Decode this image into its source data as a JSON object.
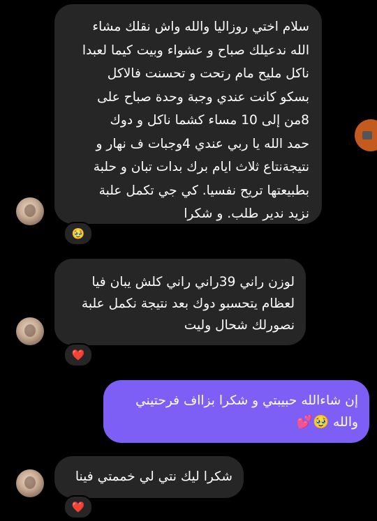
{
  "messages": [
    {
      "direction": "incoming",
      "lines": [
        "سلام اختي روزاليا والله واش نقلك مشاء",
        "الله ندعيلك صباح و عشواء وبيت كيما لعبدا",
        "ناكل مليح مام رتحت   و تحسنت فالاكل",
        "بسكو كانت عندي وجبة وحدة صباح على",
        "8من  إلى 10 مساء كشما ناكل  و دوك",
        "حمد الله يا ربي عندي 4وجبات ف نهار و",
        "نتيجةنتاع ثلاث ايام برك بدات تبان و حلبة",
        "بطبيعتها تريح نفسيا. كي  جي تكمل علبة",
        "نزيد  ندير طلب. و شكرا"
      ],
      "reaction": "🥹"
    },
    {
      "direction": "incoming",
      "lines": [
        "لوزن راني 39راني  راني كلش يبان فيا",
        "لعظام يتحسبو دوك بعد نتيجة نكمل علبة",
        "نصورلك شحال وليت"
      ],
      "reaction": "❤️"
    },
    {
      "direction": "outgoing",
      "lines": [
        "إن شاءالله حبيبتي و شكرا بزااف فرحتيني",
        "والله 🥹💕"
      ]
    },
    {
      "direction": "incoming",
      "lines": [
        "شكرا ليك نتي  لي خممتي فينا"
      ],
      "reaction": "❤️"
    }
  ],
  "colors": {
    "background": "#000000",
    "incoming_bubble": "#262626",
    "outgoing_bubble": "#7d5ff5",
    "text": "#ffffff"
  }
}
